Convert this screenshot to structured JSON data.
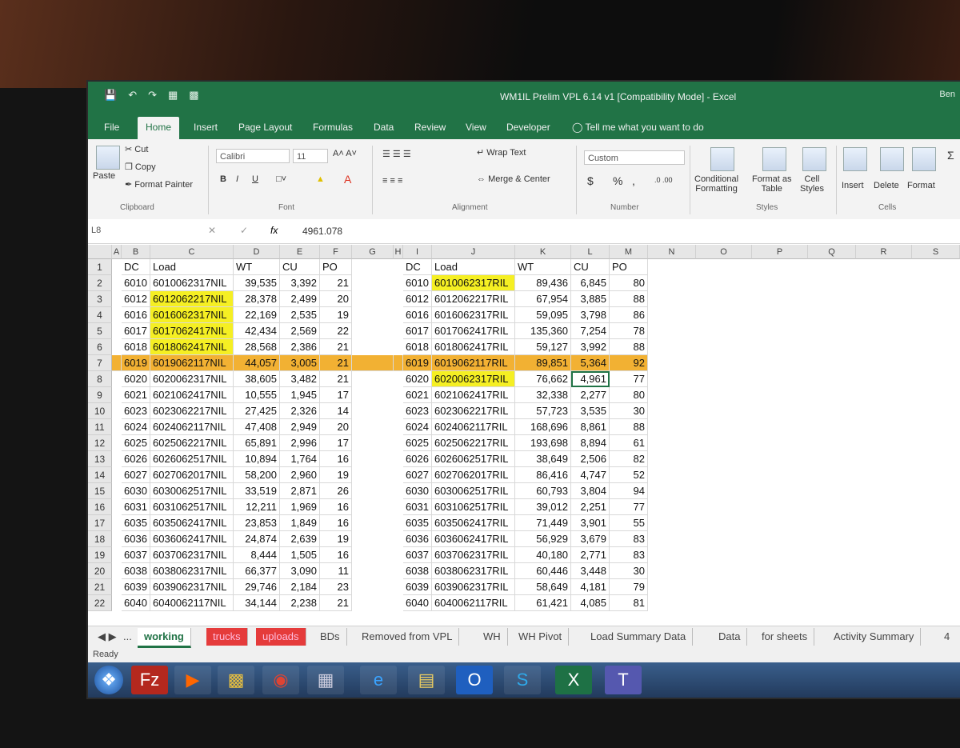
{
  "window": {
    "title": "WM1IL Prelim VPL 6.14 v1  [Compatibility Mode]  -  Excel",
    "user": "Ben"
  },
  "tabs": [
    "File",
    "Home",
    "Insert",
    "Page Layout",
    "Formulas",
    "Data",
    "Review",
    "View",
    "Developer"
  ],
  "tell_me": "Tell me what you want to do",
  "ribbon": {
    "clipboard": {
      "paste": "Paste",
      "cut": "Cut",
      "copy": "Copy",
      "format_painter": "Format Painter",
      "group": "Clipboard"
    },
    "font": {
      "name": "Calibri",
      "size": "11",
      "bold": "B",
      "italic": "I",
      "underline": "U",
      "group": "Font"
    },
    "alignment": {
      "wrap": "Wrap Text",
      "merge": "Merge & Center",
      "group": "Alignment"
    },
    "number": {
      "format": "Custom",
      "currency": "$",
      "percent": "%",
      "comma": ",",
      "group": "Number"
    },
    "styles": {
      "cond1": "Conditional",
      "cond2": "Formatting",
      "table1": "Format as",
      "table2": "Table",
      "cell1": "Cell",
      "cell2": "Styles",
      "group": "Styles"
    },
    "cells": {
      "insert": "Insert",
      "delete": "Delete",
      "format": "Format",
      "group": "Cells"
    }
  },
  "formula_bar": {
    "name_box": "L8",
    "fx": "fx",
    "value": "4961.078"
  },
  "columns": [
    "A",
    "B",
    "C",
    "D",
    "E",
    "F",
    "G",
    "H",
    "I",
    "J",
    "K",
    "L",
    "M",
    "N",
    "O",
    "P",
    "Q",
    "R",
    "S"
  ],
  "rows": [
    "1",
    "2",
    "3",
    "4",
    "5",
    "6",
    "7",
    "8",
    "9",
    "10",
    "11",
    "12",
    "13",
    "14",
    "15",
    "16",
    "17",
    "18",
    "19",
    "20",
    "21",
    "22"
  ],
  "left_table": {
    "headers": [
      "DC",
      "Load",
      "WT",
      "CU",
      "PO"
    ],
    "rows": [
      [
        "6010",
        "6010062317NIL",
        "39,535",
        "3,392",
        "21"
      ],
      [
        "6012",
        "6012062217NIL",
        "28,378",
        "2,499",
        "20"
      ],
      [
        "6016",
        "6016062317NIL",
        "22,169",
        "2,535",
        "19"
      ],
      [
        "6017",
        "6017062417NIL",
        "42,434",
        "2,569",
        "22"
      ],
      [
        "6018",
        "6018062417NIL",
        "28,568",
        "2,386",
        "21"
      ],
      [
        "6019",
        "6019062117NIL",
        "44,057",
        "3,005",
        "21"
      ],
      [
        "6020",
        "6020062317NIL",
        "38,605",
        "3,482",
        "21"
      ],
      [
        "6021",
        "6021062417NIL",
        "10,555",
        "1,945",
        "17"
      ],
      [
        "6023",
        "6023062217NIL",
        "27,425",
        "2,326",
        "14"
      ],
      [
        "6024",
        "6024062117NIL",
        "47,408",
        "2,949",
        "20"
      ],
      [
        "6025",
        "6025062217NIL",
        "65,891",
        "2,996",
        "17"
      ],
      [
        "6026",
        "6026062517NIL",
        "10,894",
        "1,764",
        "16"
      ],
      [
        "6027",
        "6027062017NIL",
        "58,200",
        "2,960",
        "19"
      ],
      [
        "6030",
        "6030062517NIL",
        "33,519",
        "2,871",
        "26"
      ],
      [
        "6031",
        "6031062517NIL",
        "12,211",
        "1,969",
        "16"
      ],
      [
        "6035",
        "6035062417NIL",
        "23,853",
        "1,849",
        "16"
      ],
      [
        "6036",
        "6036062417NIL",
        "24,874",
        "2,639",
        "19"
      ],
      [
        "6037",
        "6037062317NIL",
        "8,444",
        "1,505",
        "16"
      ],
      [
        "6038",
        "6038062317NIL",
        "66,377",
        "3,090",
        "11"
      ],
      [
        "6039",
        "6039062317NIL",
        "29,746",
        "2,184",
        "23"
      ],
      [
        "6040",
        "6040062117NIL",
        "34,144",
        "2,238",
        "21"
      ]
    ]
  },
  "right_table": {
    "headers": [
      "DC",
      "Load",
      "WT",
      "CU",
      "PO"
    ],
    "rows": [
      [
        "6010",
        "6010062317RIL",
        "89,436",
        "6,845",
        "80"
      ],
      [
        "6012",
        "6012062217RIL",
        "67,954",
        "3,885",
        "88"
      ],
      [
        "6016",
        "6016062317RIL",
        "59,095",
        "3,798",
        "86"
      ],
      [
        "6017",
        "6017062417RIL",
        "135,360",
        "7,254",
        "78"
      ],
      [
        "6018",
        "6018062417RIL",
        "59,127",
        "3,992",
        "88"
      ],
      [
        "6019",
        "6019062117RIL",
        "89,851",
        "5,364",
        "92"
      ],
      [
        "6020",
        "6020062317RIL",
        "76,662",
        "4,961",
        "77"
      ],
      [
        "6021",
        "6021062417RIL",
        "32,338",
        "2,277",
        "80"
      ],
      [
        "6023",
        "6023062217RIL",
        "57,723",
        "3,535",
        "30"
      ],
      [
        "6024",
        "6024062117RIL",
        "168,696",
        "8,861",
        "88"
      ],
      [
        "6025",
        "6025062217RIL",
        "193,698",
        "8,894",
        "61"
      ],
      [
        "6026",
        "6026062517RIL",
        "38,649",
        "2,506",
        "82"
      ],
      [
        "6027",
        "6027062017RIL",
        "86,416",
        "4,747",
        "52"
      ],
      [
        "6030",
        "6030062517RIL",
        "60,793",
        "3,804",
        "94"
      ],
      [
        "6031",
        "6031062517RIL",
        "39,012",
        "2,251",
        "77"
      ],
      [
        "6035",
        "6035062417RIL",
        "71,449",
        "3,901",
        "55"
      ],
      [
        "6036",
        "6036062417RIL",
        "56,929",
        "3,679",
        "83"
      ],
      [
        "6037",
        "6037062317RIL",
        "40,180",
        "2,771",
        "83"
      ],
      [
        "6038",
        "6038062317RIL",
        "60,446",
        "3,448",
        "30"
      ],
      [
        "6039",
        "6039062317RIL",
        "58,649",
        "4,181",
        "79"
      ],
      [
        "6040",
        "6040062117RIL",
        "61,421",
        "4,085",
        "81"
      ]
    ]
  },
  "highlight": {
    "yellow": "#f5ef23",
    "orange": "#f2b133",
    "sheet_red": "#e53b3b",
    "accent": "#217346"
  },
  "sheet_tabs": [
    "...",
    "working",
    "trucks",
    "uploads",
    "BDs",
    "Removed from VPL",
    "WH",
    "WH Pivot",
    "Load Summary Data",
    "Data",
    "for sheets",
    "Activity Summary",
    "4"
  ],
  "status": "Ready",
  "taskbar": [
    "start-orb",
    "filezilla",
    "media-player",
    "folder-files",
    "chrome",
    "calculator",
    "internet-explorer",
    "file-explorer",
    "outlook",
    "skype",
    "excel",
    "teams"
  ]
}
